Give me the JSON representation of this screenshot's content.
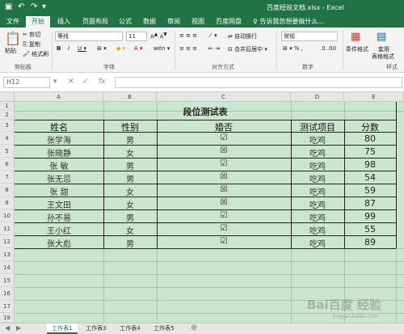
{
  "app": {
    "window_title": "百度经验文档.xlsx - Excel"
  },
  "tabs": [
    "文件",
    "开始",
    "插入",
    "页面布局",
    "公式",
    "数据",
    "审阅",
    "视图",
    "百度网盘"
  ],
  "tell_me": "告诉我您想要做什么...",
  "ribbon": {
    "clipboard": {
      "paste": "粘贴",
      "cut": "剪切",
      "copy": "复制",
      "format_painter": "格式刷",
      "label": "剪贴板"
    },
    "font": {
      "name": "等线",
      "size": "11",
      "label": "字体"
    },
    "alignment": {
      "wrap": "自动换行",
      "merge": "合并后居中",
      "label": "对齐方式"
    },
    "number": {
      "format": "常规",
      "label": "数字"
    },
    "styles": {
      "conditional": "条件格式",
      "table_fmt_1": "套用",
      "table_fmt_2": "表格格式",
      "label": "样式"
    }
  },
  "formula_bar": {
    "name_box": "H12",
    "fx": "fx",
    "value": ""
  },
  "columns": [
    "A",
    "B",
    "C",
    "D",
    "E"
  ],
  "rows": [
    "1",
    "2",
    "3",
    "4",
    "5",
    "6",
    "7",
    "8",
    "9",
    "10",
    "11",
    "12",
    "13",
    "14",
    "15",
    "16",
    "17",
    "18"
  ],
  "table": {
    "title": "段位测试表",
    "headers": [
      "姓名",
      "性别",
      "婚否",
      "测试项目",
      "分数"
    ],
    "records": [
      {
        "name": "张学海",
        "gender": "男",
        "married": "☑",
        "test": "吃鸡",
        "score": "80"
      },
      {
        "name": "张晓静",
        "gender": "女",
        "married": "☒",
        "test": "吃鸡",
        "score": "75"
      },
      {
        "name": "张  敏",
        "gender": "男",
        "married": "☑",
        "test": "吃鸡",
        "score": "98"
      },
      {
        "name": "张无忌",
        "gender": "男",
        "married": "☒",
        "test": "吃鸡",
        "score": "54"
      },
      {
        "name": "张  甜",
        "gender": "女",
        "married": "☒",
        "test": "吃鸡",
        "score": "59"
      },
      {
        "name": "王文田",
        "gender": "女",
        "married": "☒",
        "test": "吃鸡",
        "score": "87"
      },
      {
        "name": "孙不易",
        "gender": "男",
        "married": "☑",
        "test": "吃鸡",
        "score": "99"
      },
      {
        "name": "王小红",
        "gender": "女",
        "married": "☑",
        "test": "吃鸡",
        "score": "55"
      },
      {
        "name": "张大彪",
        "gender": "男",
        "married": "☑",
        "test": "吃鸡",
        "score": "89"
      }
    ]
  },
  "sheets": [
    "工作表1",
    "工作表3",
    "工作表4",
    "工作表5"
  ],
  "watermark": {
    "text": "Bai百度 经验",
    "url": "jingyan.baidu.com"
  }
}
